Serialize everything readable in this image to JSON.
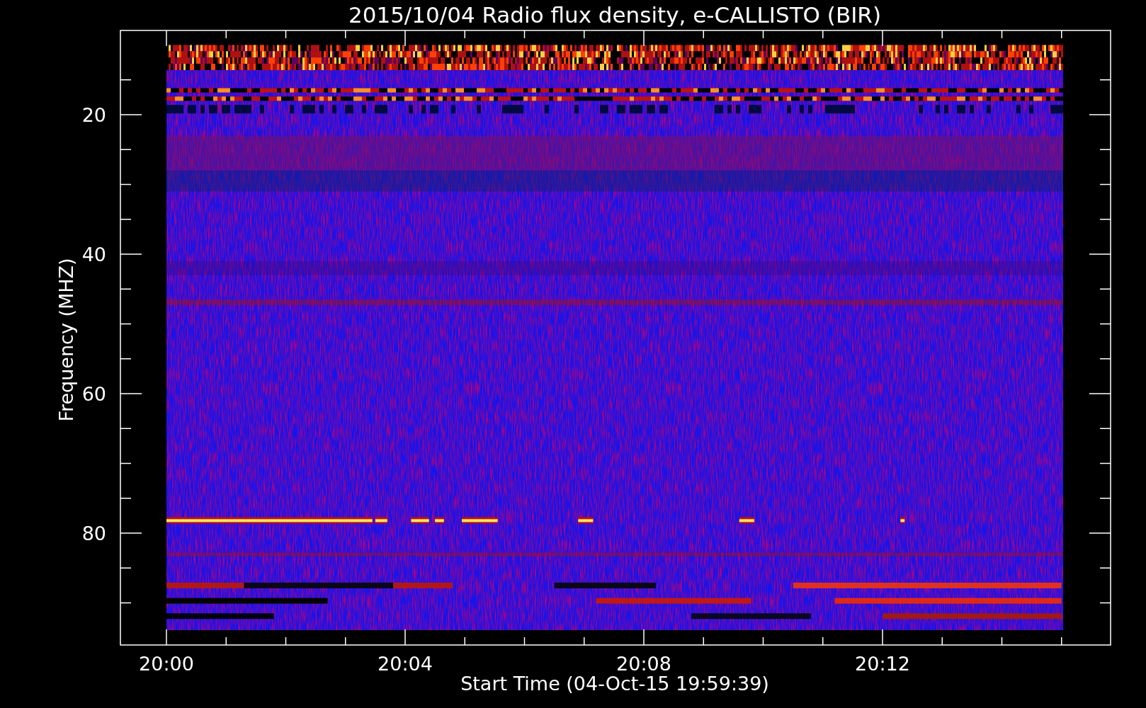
{
  "plot": {
    "title": "2015/10/04  Radio flux density, e-CALLISTO (BIR)",
    "x_axis": {
      "label": "Start Time (04-Oct-15 19:59:39)",
      "tick_labels": [
        "20:00",
        "20:04",
        "20:08",
        "20:12"
      ]
    },
    "y_axis": {
      "label": "Frequency (MHZ)",
      "tick_labels": [
        "20",
        "40",
        "60",
        "80"
      ]
    }
  }
}
